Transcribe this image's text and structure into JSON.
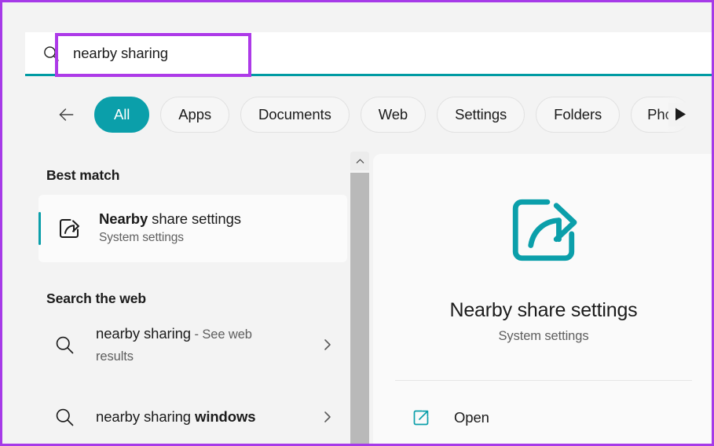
{
  "window": {
    "accent_teal": "#0B9FAA",
    "annotation_purple": "#AD3AE8",
    "background": "#F3F3F3"
  },
  "search": {
    "icon": "search-icon",
    "value": "nearby sharing",
    "placeholder": "Type here to search"
  },
  "tabs": {
    "back_icon": "arrow-left-icon",
    "overflow_next_icon": "triangle-right-icon",
    "items": [
      {
        "label": "All",
        "active": true
      },
      {
        "label": "Apps",
        "active": false
      },
      {
        "label": "Documents",
        "active": false
      },
      {
        "label": "Web",
        "active": false
      },
      {
        "label": "Settings",
        "active": false
      },
      {
        "label": "Folders",
        "active": false
      },
      {
        "label": "Phot",
        "active": false
      }
    ]
  },
  "results": {
    "best_match": {
      "header": "Best match",
      "icon": "share-icon",
      "title_bold": "Nearby",
      "title_rest": " share settings",
      "subtitle": "System settings"
    },
    "web_section": {
      "header": "Search the web",
      "rows": [
        {
          "icon": "search-icon",
          "query": "nearby sharing",
          "suffix": " - See web results",
          "bold_suffix": "",
          "chevron": "chevron-right-icon"
        },
        {
          "icon": "search-icon",
          "query": "nearby sharing ",
          "suffix": "",
          "bold_suffix": "windows",
          "chevron": "chevron-right-icon"
        }
      ]
    },
    "scrollbar": {
      "up_arrow_icon": "chevron-up-icon"
    }
  },
  "preview": {
    "icon": "share-icon",
    "title": "Nearby share settings",
    "subtitle": "System settings",
    "actions": [
      {
        "icon": "open-external-icon",
        "label": "Open"
      }
    ]
  }
}
